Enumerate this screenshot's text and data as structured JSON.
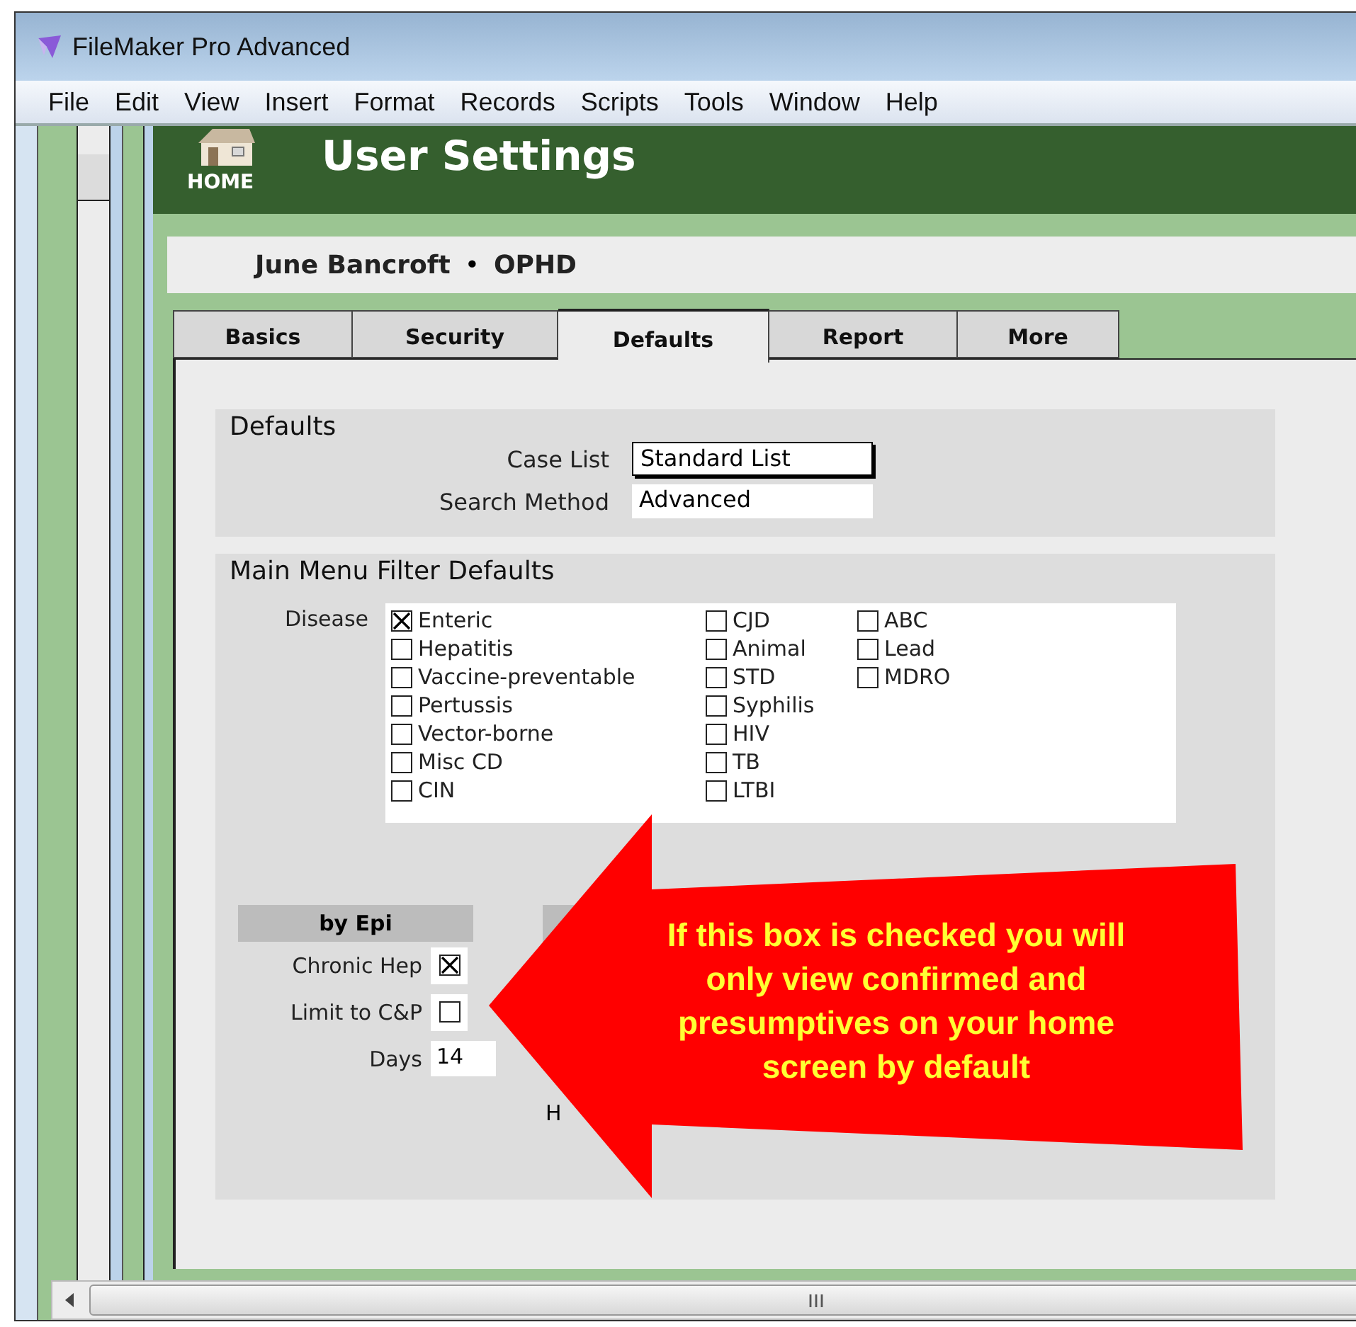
{
  "window": {
    "title": "FileMaker Pro Advanced"
  },
  "menu": [
    "File",
    "Edit",
    "View",
    "Insert",
    "Format",
    "Records",
    "Scripts",
    "Tools",
    "Window",
    "Help"
  ],
  "header": {
    "title": "User Settings",
    "home_label": "HOME"
  },
  "user": {
    "name": "June Bancroft",
    "separator": "•",
    "org": "OPHD"
  },
  "tabs": [
    {
      "label": "Basics",
      "selected": false
    },
    {
      "label": "Security",
      "selected": false
    },
    {
      "label": "Defaults",
      "selected": true
    },
    {
      "label": "Report",
      "selected": false
    },
    {
      "label": "More",
      "selected": false
    }
  ],
  "defaults": {
    "title": "Defaults",
    "fields": [
      {
        "label": "Case List",
        "value": "Standard List",
        "focused": true
      },
      {
        "label": "Search Method",
        "value": "Advanced",
        "focused": false
      }
    ]
  },
  "filter": {
    "title": "Main Menu Filter Defaults",
    "disease_label": "Disease",
    "disease_columns": [
      [
        {
          "label": "Enteric",
          "checked": true
        },
        {
          "label": "Hepatitis",
          "checked": false
        },
        {
          "label": "Vaccine-preventable",
          "checked": false
        },
        {
          "label": "Pertussis",
          "checked": false
        },
        {
          "label": "Vector-borne",
          "checked": false
        },
        {
          "label": "Misc CD",
          "checked": false
        },
        {
          "label": "CIN",
          "checked": false
        }
      ],
      [
        {
          "label": "CJD",
          "checked": false
        },
        {
          "label": "Animal",
          "checked": false
        },
        {
          "label": "STD",
          "checked": false
        },
        {
          "label": "Syphilis",
          "checked": false
        },
        {
          "label": "HIV",
          "checked": false
        },
        {
          "label": "TB",
          "checked": false
        },
        {
          "label": "LTBI",
          "checked": false
        }
      ],
      [
        {
          "label": "ABC",
          "checked": false
        },
        {
          "label": "Lead",
          "checked": false
        },
        {
          "label": "MDRO",
          "checked": false
        }
      ]
    ],
    "by_epi": {
      "title": "by Epi",
      "rows": [
        {
          "kind": "checkbox",
          "label": "Chronic Hep",
          "checked": true
        },
        {
          "kind": "checkbox",
          "label": "Limit to C&P",
          "checked": false
        },
        {
          "kind": "text",
          "label": "Days",
          "value": "14"
        }
      ]
    },
    "column_2_partial_label": "H"
  },
  "callout": {
    "text": "If this box is checked you will only view confirmed and presumptives on your home screen by default"
  }
}
